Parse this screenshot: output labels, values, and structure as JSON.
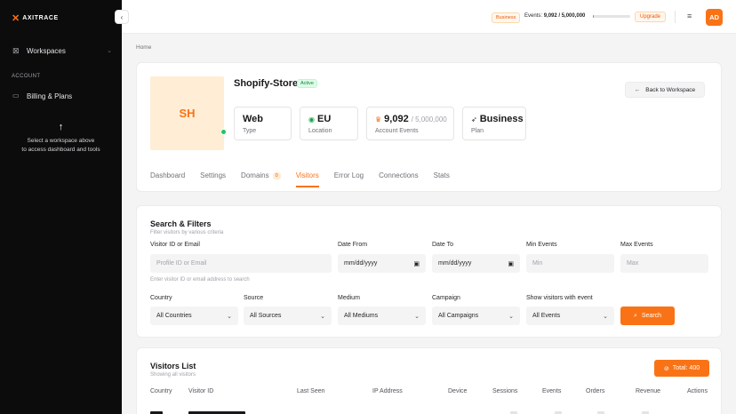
{
  "sidebar": {
    "logo_mark": "✕",
    "logo_text": "AXITRACE",
    "collapse_icon": "‹",
    "workspaces_label": "Workspaces",
    "section_label": "ACCOUNT",
    "billing_label": "Billing & Plans",
    "hint_line1": "Select a workspace above",
    "hint_line2": "to access dashboard and tools"
  },
  "topbar": {
    "plan_badge": "Business",
    "events_label": "Events:",
    "events_value": "9,092 / 5,000,000",
    "events_fraction": 0.0018,
    "upgrade_label": "Upgrade",
    "avatar_initials": "AD"
  },
  "breadcrumb": "Home",
  "workspace": {
    "initials": "SH",
    "name": "Shopify-Store",
    "status": "Active",
    "back_label": "Back to Workspace",
    "stats": {
      "type_value": "Web",
      "type_label": "Type",
      "location_value": "EU",
      "location_label": "Location",
      "events_value": "9,092",
      "events_limit": "/ 5,000,000",
      "events_label": "Account Events",
      "plan_value": "Business",
      "plan_label": "Plan"
    },
    "tabs": [
      {
        "label": "Dashboard"
      },
      {
        "label": "Settings"
      },
      {
        "label": "Domains",
        "count": "0"
      },
      {
        "label": "Visitors",
        "active": true
      },
      {
        "label": "Error Log"
      },
      {
        "label": "Connections"
      },
      {
        "label": "Stats"
      }
    ]
  },
  "filters": {
    "title": "Search & Filters",
    "subtitle": "Filter visitors by various criteria",
    "visitor_label": "Visitor ID or Email",
    "visitor_placeholder": "Profile ID or Email",
    "visitor_help": "Enter visitor ID or email address to search",
    "date_from_label": "Date From",
    "date_from_value": "mm/dd/yyyy",
    "date_to_label": "Date To",
    "date_to_value": "mm/dd/yyyy",
    "min_events_label": "Min Events",
    "min_events_placeholder": "Min",
    "max_events_label": "Max Events",
    "max_events_placeholder": "Max",
    "country_label": "Country",
    "country_value": "All Countries",
    "source_label": "Source",
    "source_value": "All Sources",
    "medium_label": "Medium",
    "medium_value": "All Mediums",
    "campaign_label": "Campaign",
    "campaign_value": "All Campaigns",
    "event_label": "Show visitors with event",
    "event_value": "All Events",
    "search_label": "Search"
  },
  "visitors": {
    "title": "Visitors List",
    "subtitle": "Showing all visitors",
    "total_label": "Total: 400",
    "columns": [
      "Country",
      "Visitor ID",
      "Last Seen",
      "IP Address",
      "Device",
      "Sessions",
      "Events",
      "Orders",
      "Revenue",
      "Actions"
    ]
  },
  "colors": {
    "accent": "#f97316",
    "sidebar_bg": "#0c0c0d",
    "active_green": "#22c55e"
  }
}
